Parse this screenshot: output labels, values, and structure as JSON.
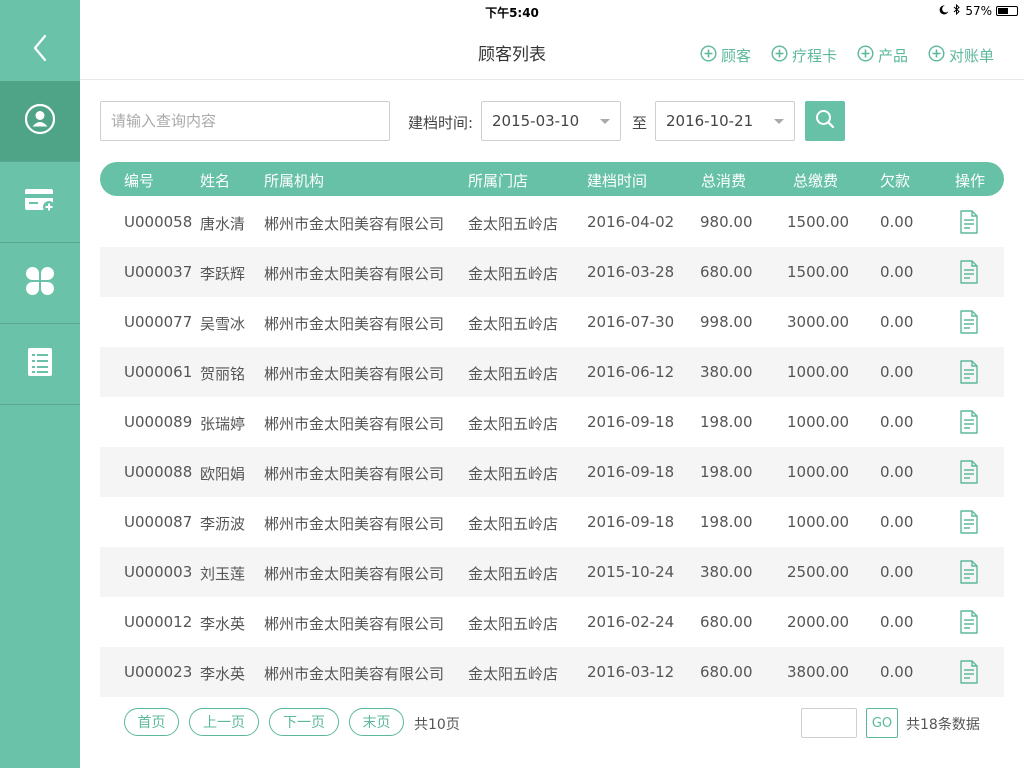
{
  "status_bar": {
    "device": "iPad",
    "time": "下午5:40",
    "battery": "57%",
    "battery_level": 0.57
  },
  "header": {
    "title": "顾客列表",
    "actions": [
      {
        "label": "顾客",
        "icon": "plus-circle-icon"
      },
      {
        "label": "疗程卡",
        "icon": "plus-circle-icon"
      },
      {
        "label": "产品",
        "icon": "plus-circle-icon"
      },
      {
        "label": "对账单",
        "icon": "plus-circle-icon"
      }
    ]
  },
  "sidebar": {
    "back_icon": "chevron-left-icon",
    "items": [
      {
        "icon": "user-circle-icon",
        "active": true
      },
      {
        "icon": "card-add-icon",
        "active": false
      },
      {
        "icon": "clover-icon",
        "active": false
      },
      {
        "icon": "list-icon",
        "active": false
      }
    ]
  },
  "search": {
    "placeholder": "请输入查询内容",
    "value": "",
    "date_label": "建档时间:",
    "date_from": "2015-03-10",
    "to_label": "至",
    "date_to": "2016-10-21",
    "button_icon": "search-icon"
  },
  "table": {
    "columns": [
      "编号",
      "姓名",
      "所属机构",
      "所属门店",
      "建档时间",
      "总消费",
      "总缴费",
      "欠款",
      "操作"
    ],
    "rows": [
      [
        "U000058",
        "唐水清",
        "郴州市金太阳美容有限公司",
        "金太阳五岭店",
        "2016-04-02",
        "980.00",
        "1500.00",
        "0.00"
      ],
      [
        "U000037",
        "李跃辉",
        "郴州市金太阳美容有限公司",
        "金太阳五岭店",
        "2016-03-28",
        "680.00",
        "1500.00",
        "0.00"
      ],
      [
        "U000077",
        "吴雪冰",
        "郴州市金太阳美容有限公司",
        "金太阳五岭店",
        "2016-07-30",
        "998.00",
        "3000.00",
        "0.00"
      ],
      [
        "U000061",
        "贺丽铭",
        "郴州市金太阳美容有限公司",
        "金太阳五岭店",
        "2016-06-12",
        "380.00",
        "1000.00",
        "0.00"
      ],
      [
        "U000089",
        "张瑞婷",
        "郴州市金太阳美容有限公司",
        "金太阳五岭店",
        "2016-09-18",
        "198.00",
        "1000.00",
        "0.00"
      ],
      [
        "U000088",
        "欧阳娟",
        "郴州市金太阳美容有限公司",
        "金太阳五岭店",
        "2016-09-18",
        "198.00",
        "1000.00",
        "0.00"
      ],
      [
        "U000087",
        "李沥波",
        "郴州市金太阳美容有限公司",
        "金太阳五岭店",
        "2016-09-18",
        "198.00",
        "1000.00",
        "0.00"
      ],
      [
        "U000003",
        "刘玉莲",
        "郴州市金太阳美容有限公司",
        "金太阳五岭店",
        "2015-10-24",
        "380.00",
        "2500.00",
        "0.00"
      ],
      [
        "U000012",
        "李水英",
        "郴州市金太阳美容有限公司",
        "金太阳五岭店",
        "2016-02-24",
        "680.00",
        "2000.00",
        "0.00"
      ],
      [
        "U000023",
        "李水英",
        "郴州市金太阳美容有限公司",
        "金太阳五岭店",
        "2016-03-12",
        "680.00",
        "3800.00",
        "0.00"
      ]
    ],
    "row_action_icon": "document-icon"
  },
  "pagination": {
    "first": "首页",
    "prev": "上一页",
    "next": "下一页",
    "last": "末页",
    "total_pages": "共10页",
    "page_input_value": "",
    "go": "GO",
    "total_records": "共18条数据"
  },
  "colors": {
    "primary": "#66c1a6",
    "sidebar": "#6ac3a8",
    "sidebar_active": "#4fa487",
    "row_alt": "#f5f5f5"
  }
}
